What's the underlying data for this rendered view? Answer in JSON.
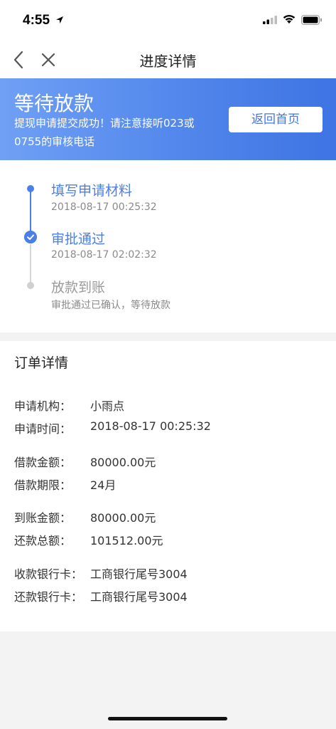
{
  "status_bar": {
    "time": "4:55"
  },
  "nav": {
    "title": "进度详情"
  },
  "banner": {
    "title": "等待放款",
    "message": "提现申请提交成功！请注意接听023或0755的审核电话",
    "button_label": "返回首页"
  },
  "progress": {
    "steps": [
      {
        "title": "填写申请材料",
        "subtitle": "2018-08-17 00:25:32",
        "state": "done"
      },
      {
        "title": "审批通过",
        "subtitle": "2018-08-17 02:02:32",
        "state": "current"
      },
      {
        "title": "放款到账",
        "subtitle": "审批通过已确认，等待放款",
        "state": "pending"
      }
    ]
  },
  "order": {
    "title": "订单详情",
    "rows": [
      {
        "label": "申请机构：",
        "value": "小雨点"
      },
      {
        "label": "申请时间：",
        "value": "2018-08-17 00:25:32"
      },
      {
        "label": "借款金额：",
        "value": "80000.00元"
      },
      {
        "label": "借款期限：",
        "value": "24月"
      },
      {
        "label": "到账金额：",
        "value": "80000.00元"
      },
      {
        "label": "还款总额：",
        "value": "101512.00元"
      },
      {
        "label": "收款银行卡：",
        "value": "工商银行尾号3004"
      },
      {
        "label": "还款银行卡：",
        "value": "工商银行尾号3004"
      }
    ]
  },
  "colors": {
    "accent": "#4a7fe8",
    "banner_start": "#6fa0f5",
    "banner_end": "#3e74e3",
    "pending": "#d0d0d0"
  }
}
